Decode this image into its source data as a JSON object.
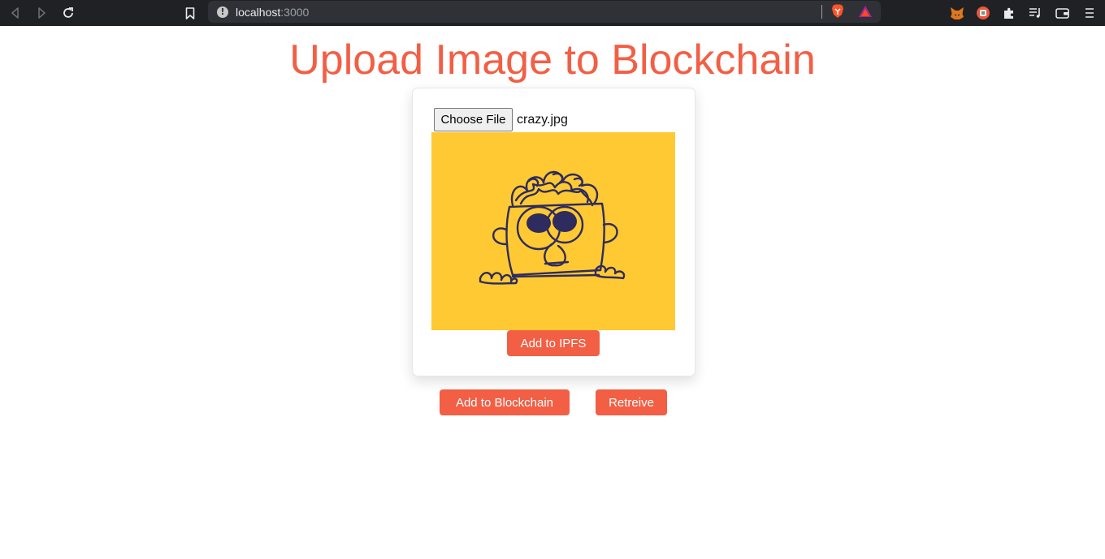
{
  "browser": {
    "url_host": "localhost",
    "url_port": ":3000"
  },
  "page": {
    "title": "Upload Image to Blockchain",
    "file_input": {
      "button_label": "Choose File",
      "file_name": "crazy.jpg"
    },
    "preview": {
      "background_color": "#fec932"
    },
    "add_ipfs_label": "Add to IPFS",
    "add_blockchain_label": "Add to Blockchain",
    "retrieve_label": "Retreive"
  },
  "colors": {
    "accent": "#f25f45",
    "illustration": "#2e2b5e"
  }
}
